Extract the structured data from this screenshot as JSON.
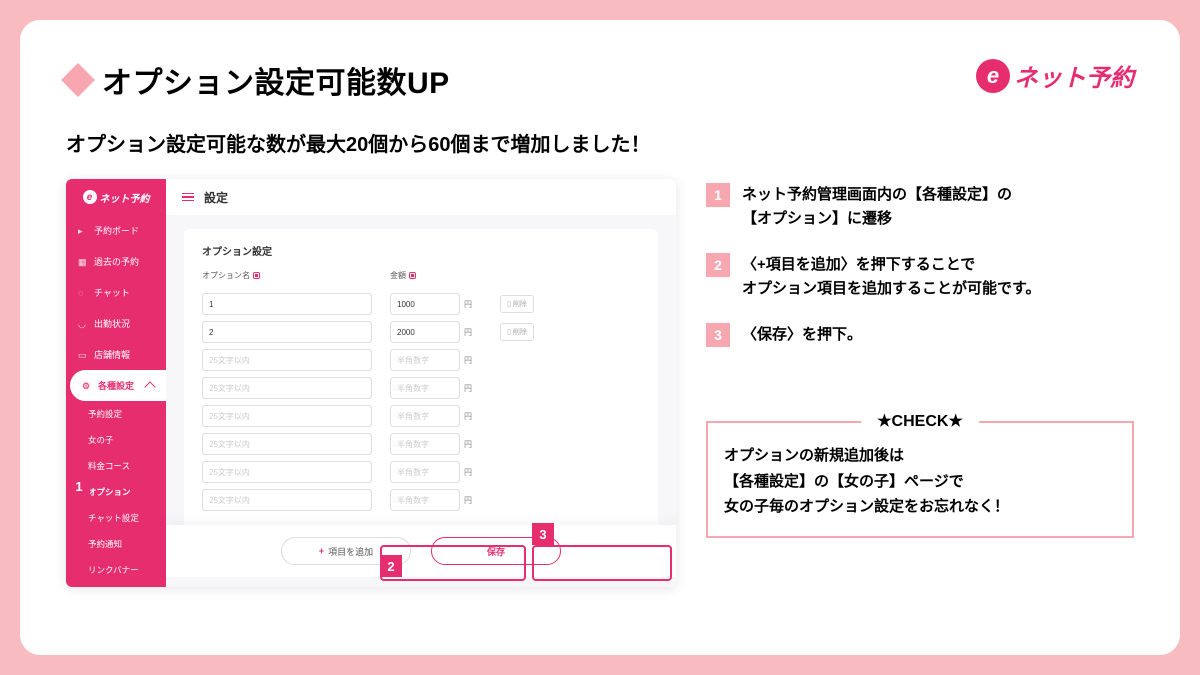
{
  "header": {
    "title": "オプション設定可能数UP",
    "logo_text": "ネット予約",
    "logo_e": "e"
  },
  "subtitle": "オプション設定可能な数が最大20個から60個まで増加しました！",
  "screenshot": {
    "sidebar_logo": "ネット予約",
    "sidebar_items": [
      "予約ボード",
      "過去の予約",
      "チャット",
      "出勤状況",
      "店舗情報",
      "各種設定"
    ],
    "sidebar_subs": [
      "予約設定",
      "女の子",
      "料金コース",
      "オプション",
      "チャット設定",
      "予約通知",
      "リンクバナー"
    ],
    "main_title": "設定",
    "panel_title": "オプション設定",
    "col_name": "オプション名",
    "col_price": "金額",
    "rows": [
      {
        "name": "1",
        "price": "1000",
        "filled": true
      },
      {
        "name": "2",
        "price": "2000",
        "filled": true
      },
      {
        "name": "25文字以内",
        "price": "半角数字",
        "filled": false
      },
      {
        "name": "25文字以内",
        "price": "半角数字",
        "filled": false
      },
      {
        "name": "25文字以内",
        "price": "半角数字",
        "filled": false
      },
      {
        "name": "25文字以内",
        "price": "半角数字",
        "filled": false
      },
      {
        "name": "25文字以内",
        "price": "半角数字",
        "filled": false
      },
      {
        "name": "25文字以内",
        "price": "半角数字",
        "filled": false
      }
    ],
    "yen": "円",
    "delete_label": "削除",
    "add_label": "項目を追加",
    "save_label": "保存"
  },
  "callouts": {
    "c1": "1",
    "c2": "2",
    "c3": "3"
  },
  "steps": [
    {
      "num": "1",
      "text": "ネット予約管理画面内の【各種設定】の\n【オプション】に遷移"
    },
    {
      "num": "2",
      "text": "〈+項目を追加〉を押下することで\nオプション項目を追加することが可能です。"
    },
    {
      "num": "3",
      "text": "〈保存〉を押下。"
    }
  ],
  "check": {
    "title": "★CHECK★",
    "body": "オプションの新規追加後は\n【各種設定】の【女の子】ページで\n女の子毎のオプション設定をお忘れなく！"
  }
}
